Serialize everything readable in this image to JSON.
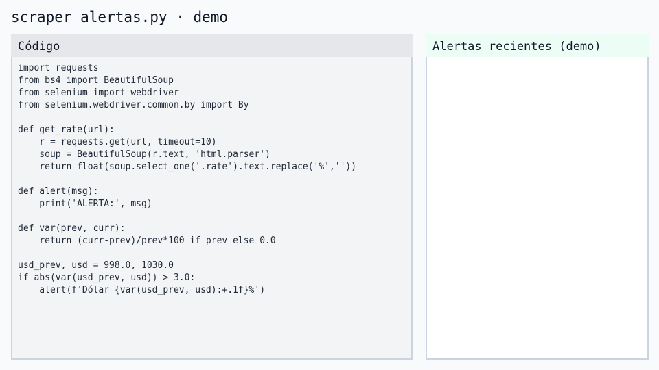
{
  "window": {
    "title": "scraper_alertas.py · demo"
  },
  "code_panel": {
    "header": "Código",
    "lines": [
      "import requests",
      "from bs4 import BeautifulSoup",
      "from selenium import webdriver",
      "from selenium.webdriver.common.by import By",
      "",
      "def get_rate(url):",
      "    r = requests.get(url, timeout=10)",
      "    soup = BeautifulSoup(r.text, 'html.parser')",
      "    return float(soup.select_one('.rate').text.replace('%',''))",
      "",
      "def alert(msg):",
      "    print('ALERTA:', msg)",
      "",
      "def var(prev, curr):",
      "    return (curr-prev)/prev*100 if prev else 0.0",
      "",
      "usd_prev, usd = 998.0, 1030.0",
      "if abs(var(usd_prev, usd)) > 3.0:",
      "    alert(f'Dólar {var(usd_prev, usd):+.1f}%')"
    ]
  },
  "alerts_panel": {
    "header": "Alertas recientes (demo)",
    "items": []
  },
  "colors": {
    "page_bg": "#f8fafc",
    "code_panel_bg": "#f3f4f6",
    "code_header_bg": "#e5e7eb",
    "alerts_header_bg": "#ecfdf5",
    "panel_border": "#cbd5e1"
  }
}
